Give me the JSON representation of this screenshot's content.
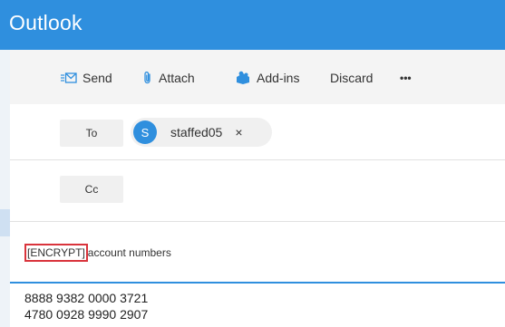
{
  "app": {
    "title": "Outlook"
  },
  "toolbar": {
    "send_label": "Send",
    "attach_label": "Attach",
    "addins_label": "Add-ins",
    "discard_label": "Discard",
    "more_label": "•••"
  },
  "to": {
    "label": "To",
    "recipient": {
      "initial": "S",
      "name": "staffed05",
      "remove": "×"
    }
  },
  "cc": {
    "label": "Cc"
  },
  "subject": {
    "tag": "[ENCRYPT]",
    "text": "account numbers"
  },
  "body": {
    "lines": [
      "8888 9382 0000 3721",
      "4780 0928 9990 2907"
    ]
  },
  "colors": {
    "brand": "#2f8fde",
    "highlight_box": "#d9343c"
  },
  "icons": [
    "send-icon",
    "paperclip-icon",
    "addins-icon",
    "more-icon",
    "close-icon"
  ]
}
